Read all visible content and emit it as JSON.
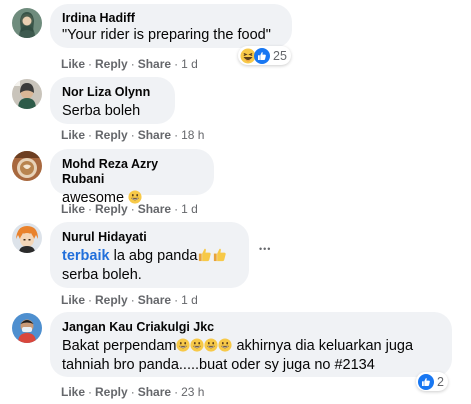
{
  "comments": [
    {
      "name": "Irdina Hadiff",
      "text": "\"Your rider is preparing the food\"",
      "actions": {
        "like": "Like",
        "reply": "Reply",
        "share": "Share",
        "time": "1 d"
      },
      "reactions": {
        "icons": [
          "haha-icon",
          "like-icon"
        ],
        "count": "25"
      }
    },
    {
      "name": "Nor Liza Olynn",
      "text": "Serba boleh",
      "actions": {
        "like": "Like",
        "reply": "Reply",
        "share": "Share",
        "time": "18 h"
      }
    },
    {
      "name": "Mohd Reza Azry Rubani",
      "text": "awesome",
      "text_emoji": "grinning-face",
      "actions": {
        "like": "Like",
        "reply": "Reply",
        "share": "Share",
        "time": "1 d"
      }
    },
    {
      "name": "Nurul Hidayati",
      "tag": "terbaik",
      "text1": "la abg panda",
      "text1_emoji": [
        "thumbs-up",
        "thumbs-up"
      ],
      "text2": "serba boleh.",
      "more": "•••",
      "actions": {
        "like": "Like",
        "reply": "Reply",
        "share": "Share",
        "time": "1 d"
      }
    },
    {
      "name": "Jangan Kau Criakulgi Jkc",
      "text1a": "Bakat perpendam",
      "text1_emoji": [
        "grinning-face",
        "grinning-face",
        "grinning-face",
        "grinning-face"
      ],
      "text1b": " akhirnya dia keluarkan juga",
      "text2": "tahniah bro panda.....buat oder sy juga no #2134",
      "actions": {
        "like": "Like",
        "reply": "Reply",
        "share": "Share",
        "time": "23 h"
      },
      "reactions": {
        "icons": [
          "like-icon"
        ],
        "count": "2"
      }
    }
  ],
  "colors": {
    "bubble": "#f0f2f5",
    "secondary_text": "#65676b",
    "tag": "#216fdb",
    "like_blue": "#1877f2",
    "emoji_yellow": "#f7c948"
  }
}
